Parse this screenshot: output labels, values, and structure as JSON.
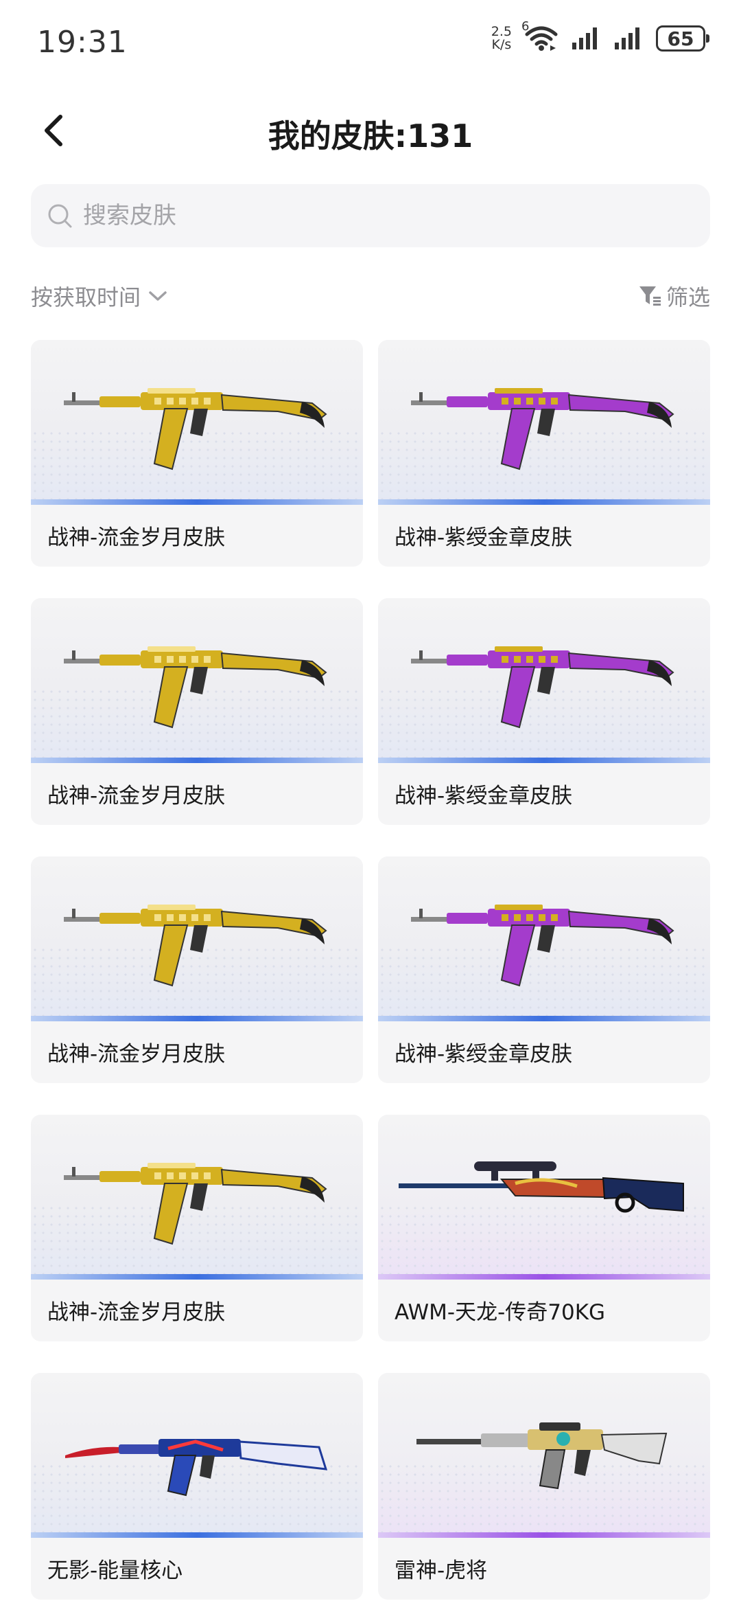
{
  "status_bar": {
    "time": "19:31",
    "net_speed_value": "2.5",
    "net_speed_unit": "K/s",
    "wifi_label": "6",
    "battery": "65"
  },
  "header": {
    "title": "我的皮肤:131",
    "back_icon": "chevron-left-icon"
  },
  "search": {
    "placeholder": "搜索皮肤",
    "value": ""
  },
  "toolbar": {
    "sort_label": "按获取时间",
    "filter_label": "筛选"
  },
  "colors": {
    "accent_blue": "#3b6fe0",
    "accent_purple": "#9a52e6",
    "gold": "#d4b020",
    "violet": "#a43ccc"
  },
  "skins": [
    {
      "name": "战神-流金岁月皮肤",
      "weapon": "ak-gold",
      "rarity": "blue"
    },
    {
      "name": "战神-紫绶金章皮肤",
      "weapon": "ak-purple",
      "rarity": "blue"
    },
    {
      "name": "战神-流金岁月皮肤",
      "weapon": "ak-gold",
      "rarity": "blue"
    },
    {
      "name": "战神-紫绶金章皮肤",
      "weapon": "ak-purple",
      "rarity": "blue"
    },
    {
      "name": "战神-流金岁月皮肤",
      "weapon": "ak-gold",
      "rarity": "blue"
    },
    {
      "name": "战神-紫绶金章皮肤",
      "weapon": "ak-purple",
      "rarity": "blue"
    },
    {
      "name": "战神-流金岁月皮肤",
      "weapon": "ak-gold",
      "rarity": "blue"
    },
    {
      "name": "AWM-天龙-传奇70KG",
      "weapon": "awm",
      "rarity": "purple"
    },
    {
      "name": "无影-能量核心",
      "weapon": "ak-energy",
      "rarity": "blue"
    },
    {
      "name": "雷神-虎将",
      "weapon": "m4-tiger",
      "rarity": "purple"
    }
  ]
}
